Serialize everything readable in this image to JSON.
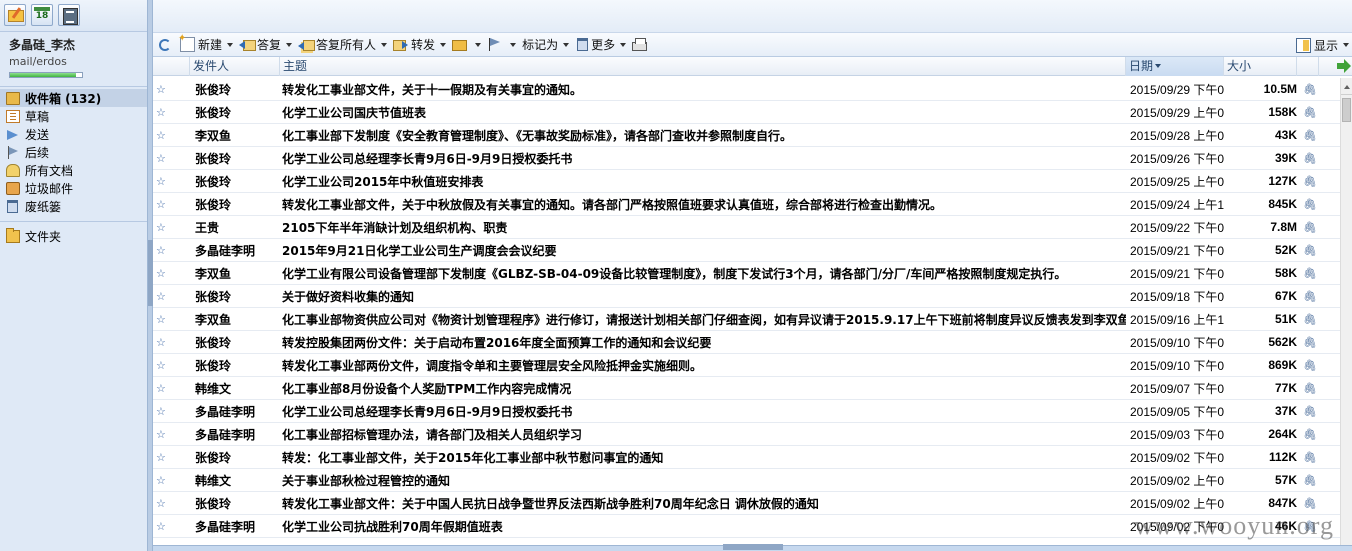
{
  "sidebar": {
    "tools": [
      {
        "icon": "compose-mail-icon"
      },
      {
        "icon": "calendar-icon",
        "text": "18"
      },
      {
        "icon": "notes-icon"
      }
    ],
    "user": {
      "name": "多晶硅_李杰",
      "account": "mail/erdos",
      "quota_fraction": 0.92
    },
    "folders": [
      {
        "label": "收件箱 (132)",
        "icon": "inbox-icon",
        "selected": true
      },
      {
        "label": "草稿",
        "icon": "drafts-icon"
      },
      {
        "label": "发送",
        "icon": "sent-icon"
      },
      {
        "label": "后续",
        "icon": "followup-flag-icon"
      },
      {
        "label": "所有文档",
        "icon": "all-documents-icon"
      },
      {
        "label": "垃圾邮件",
        "icon": "junk-icon"
      },
      {
        "label": "废纸篓",
        "icon": "trash-icon"
      }
    ],
    "folder_root": {
      "label": "文件夹",
      "icon": "folder-icon"
    }
  },
  "toolbar": {
    "new_label": "新建",
    "reply_label": "答复",
    "reply_all_label": "答复所有人",
    "forward_label": "转发",
    "mark_as_label": "标记为",
    "more_label": "更多",
    "display_label": "显示"
  },
  "list_header": {
    "sender": "发件人",
    "subject": "主题",
    "date": "日期",
    "size": "大小"
  },
  "messages": [
    {
      "sender": "张俊玲",
      "subject": "转发化工事业部文件，关于十一假期及有关事宜的通知。",
      "date": "2015/09/29 下午0",
      "size": "10.5M"
    },
    {
      "sender": "张俊玲",
      "subject": "化学工业公司国庆节值班表",
      "date": "2015/09/29 上午0",
      "size": "158K"
    },
    {
      "sender": "李双鱼",
      "subject": "化工事业部下发制度《安全教育管理制度》、《无事故奖励标准》，请各部门查收并参照制度自行。",
      "date": "2015/09/28 上午0",
      "size": "43K"
    },
    {
      "sender": "张俊玲",
      "subject": "化学工业公司总经理李长青9月6日-9月9日授权委托书",
      "date": "2015/09/26 下午0",
      "size": "39K"
    },
    {
      "sender": "张俊玲",
      "subject": "化学工业公司2015年中秋值班安排表",
      "date": "2015/09/25 上午0",
      "size": "127K"
    },
    {
      "sender": "张俊玲",
      "subject": "转发化工事业部文件，关于中秋放假及有关事宜的通知。请各部门严格按照值班要求认真值班，综合部将进行检查出勤情况。",
      "date": "2015/09/24 上午1",
      "size": "845K"
    },
    {
      "sender": "王贵",
      "subject": "2105下年半年消缺计划及组织机构、职责",
      "date": "2015/09/22 下午0",
      "size": "7.8M"
    },
    {
      "sender": "多晶硅李明",
      "subject": "2015年9月21日化学工业公司生产调度会会议纪要",
      "date": "2015/09/21 下午0",
      "size": "52K"
    },
    {
      "sender": "李双鱼",
      "subject": "化学工业有限公司设备管理部下发制度《GLBZ-SB-04-09设备比较管理制度》，制度下发试行3个月，请各部门/分厂/车间严格按照制度规定执行。",
      "date": "2015/09/21 下午0",
      "size": "58K"
    },
    {
      "sender": "张俊玲",
      "subject": "关于做好资料收集的通知",
      "date": "2015/09/18 下午0",
      "size": "67K"
    },
    {
      "sender": "李双鱼",
      "subject": "化工事业部物资供应公司对《物资计划管理程序》进行修订，请报送计划相关部门仔细查阅，如有异议请于2015.9.17上午下班前将制度异议反馈表发到李双鱼处。",
      "date": "2015/09/16 上午1",
      "size": "51K"
    },
    {
      "sender": "张俊玲",
      "subject": "转发控股集团两份文件：关于启动布置2016年度全面预算工作的通知和会议纪要",
      "date": "2015/09/10 下午0",
      "size": "562K"
    },
    {
      "sender": "张俊玲",
      "subject": "转发化工事业部两份文件，调度指令单和主要管理层安全风险抵押金实施细则。",
      "date": "2015/09/10 下午0",
      "size": "869K"
    },
    {
      "sender": "韩维文",
      "subject": "化工事业部8月份设备个人奖励TPM工作内容完成情况",
      "date": "2015/09/07 下午0",
      "size": "77K"
    },
    {
      "sender": "多晶硅李明",
      "subject": "化学工业公司总经理李长青9月6日-9月9日授权委托书",
      "date": "2015/09/05 下午0",
      "size": "37K"
    },
    {
      "sender": "多晶硅李明",
      "subject": "化工事业部招标管理办法，请各部门及相关人员组织学习",
      "date": "2015/09/03 下午0",
      "size": "264K"
    },
    {
      "sender": "张俊玲",
      "subject": "转发：化工事业部文件，关于2015年化工事业部中秋节慰问事宜的通知",
      "date": "2015/09/02 下午0",
      "size": "112K"
    },
    {
      "sender": "韩维文",
      "subject": "关于事业部秋检过程管控的通知",
      "date": "2015/09/02 上午0",
      "size": "57K"
    },
    {
      "sender": "张俊玲",
      "subject": "转发化工事业部文件：关于中国人民抗日战争暨世界反法西斯战争胜利70周年纪念日 调休放假的通知",
      "date": "2015/09/02 上午0",
      "size": "847K"
    },
    {
      "sender": "多晶硅李明",
      "subject": "化学工业公司抗战胜利70周年假期值班表",
      "date": "2015/09/02 下午0",
      "size": "46K"
    }
  ],
  "watermark": "www.wooyun.org"
}
